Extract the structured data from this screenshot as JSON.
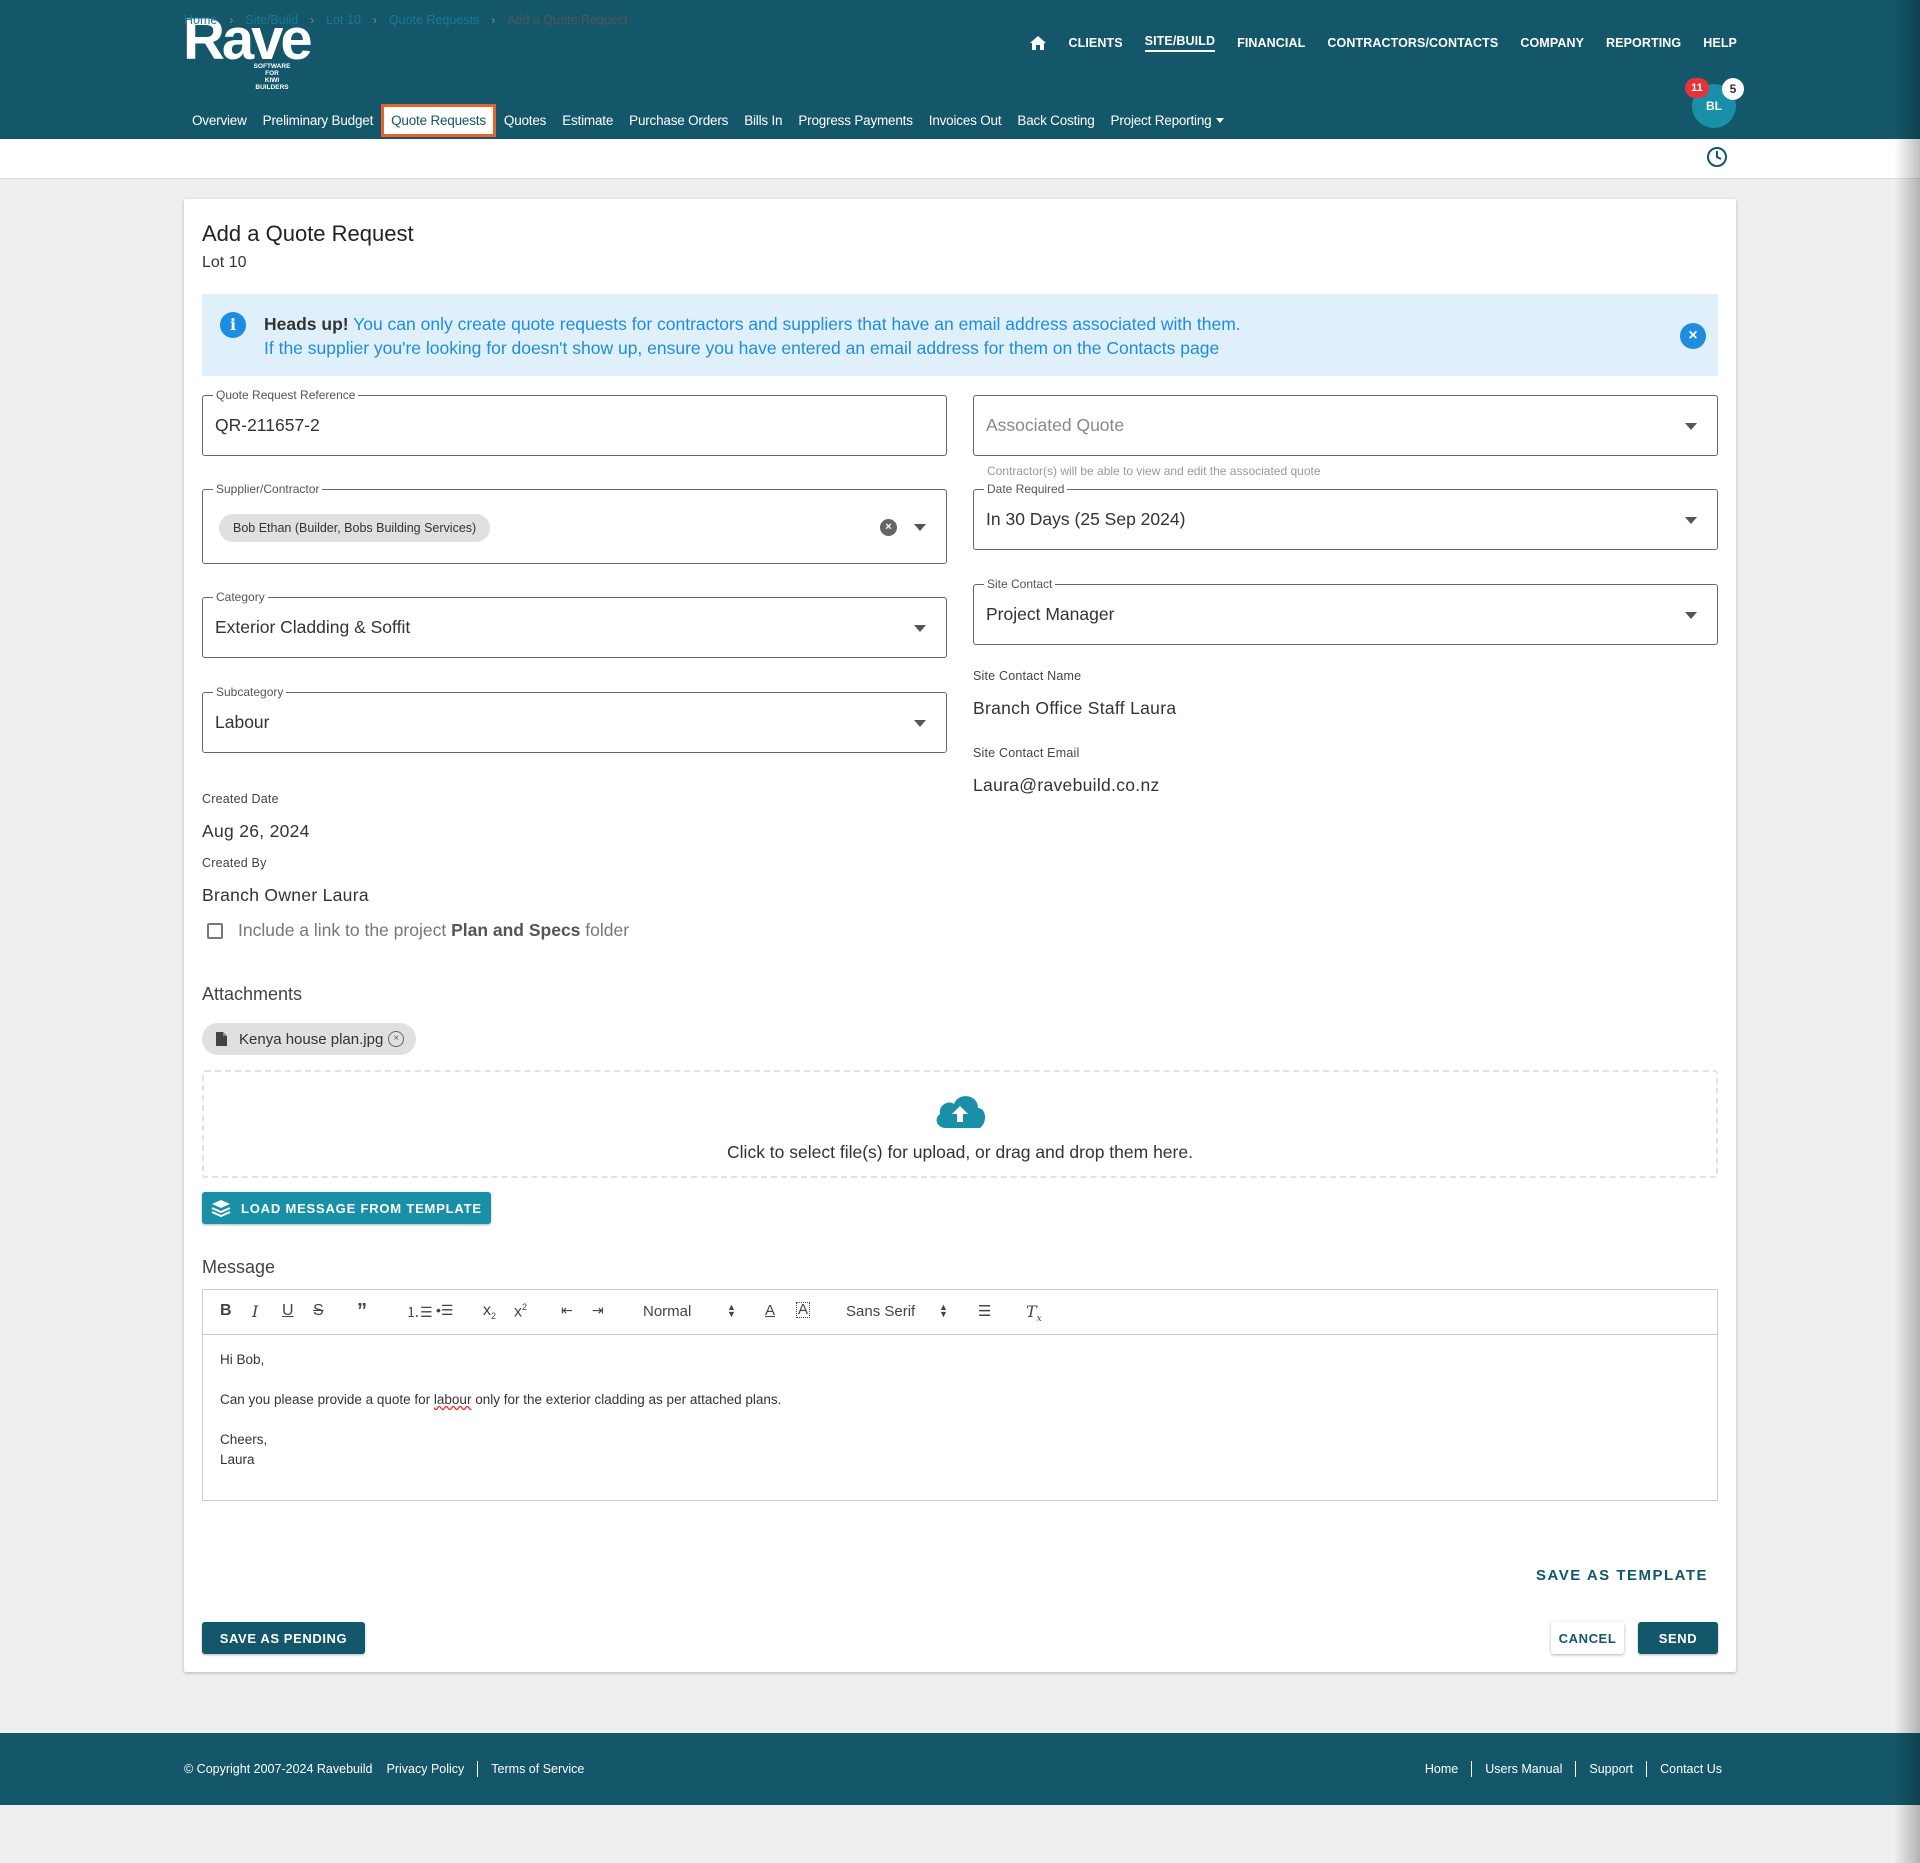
{
  "brand": {
    "name": "Rave",
    "tagline_1": "SOFTWARE FOR",
    "tagline_2": "KIWI BUILDERS"
  },
  "top_nav": [
    "CLIENTS",
    "SITE/BUILD",
    "FINANCIAL",
    "CONTRACTORS/CONTACTS",
    "COMPANY",
    "REPORTING",
    "HELP"
  ],
  "sub_nav": [
    "Overview",
    "Preliminary Budget",
    "Quote Requests",
    "Quotes",
    "Estimate",
    "Purchase Orders",
    "Bills In",
    "Progress Payments",
    "Invoices Out",
    "Back Costing",
    "Project Reporting"
  ],
  "user": {
    "initials": "BL",
    "notifications": "11",
    "messages": "5"
  },
  "breadcrumb": [
    "Home",
    "Site/Build",
    "Lot 10",
    "Quote Requests",
    "Add a Quote Request"
  ],
  "page": {
    "title": "Add a Quote Request",
    "subtitle": "Lot 10"
  },
  "alert": {
    "lead": "Heads up!",
    "line1": "You can only create quote requests for contractors and suppliers that have an email address associated with them.",
    "line2": "If the supplier you're looking for doesn't show up, ensure you have entered an email address for them on the Contacts page"
  },
  "form": {
    "reference": {
      "label": "Quote Request Reference",
      "value": "QR-211657-2"
    },
    "associated_quote": {
      "placeholder": "Associated Quote",
      "helper": "Contractor(s) will be able to view and edit the associated quote"
    },
    "supplier": {
      "label": "Supplier/Contractor",
      "chip": "Bob Ethan (Builder, Bobs Building Services)"
    },
    "date_required": {
      "label": "Date Required",
      "value": "In 30 Days (25 Sep 2024)"
    },
    "category": {
      "label": "Category",
      "value": "Exterior Cladding & Soffit"
    },
    "site_contact": {
      "label": "Site Contact",
      "value": "Project Manager"
    },
    "subcategory": {
      "label": "Subcategory",
      "value": "Labour"
    },
    "site_contact_name": {
      "label": "Site Contact Name",
      "value": "Branch Office Staff Laura"
    },
    "site_contact_email": {
      "label": "Site Contact Email",
      "value": "Laura@ravebuild.co.nz"
    },
    "created_date": {
      "label": "Created Date",
      "value": "Aug 26, 2024"
    },
    "created_by": {
      "label": "Created By",
      "value": "Branch Owner Laura"
    },
    "plan_link": {
      "pre": "Include a link to the project",
      "bold": "Plan and Specs",
      "post": "folder",
      "checked": false
    }
  },
  "attachments": {
    "label": "Attachments",
    "files": [
      "Kenya house plan.jpg"
    ],
    "dropzone_text": "Click to select file(s) for upload, or drag and drop them here."
  },
  "template_button": "LOAD MESSAGE FROM TEMPLATE",
  "message": {
    "label": "Message",
    "toolbar": {
      "size": "Normal",
      "font": "Sans Serif"
    },
    "greeting": "Hi Bob,",
    "body_pre": "Can you please provide a quote for",
    "body_word": "labour",
    "body_post": "only for the exterior cladding as per attached plans.",
    "signoff": "Cheers,",
    "signature": "Laura"
  },
  "actions": {
    "save_template": "SAVE AS TEMPLATE",
    "save_pending": "SAVE AS PENDING",
    "cancel": "CANCEL",
    "send": "SEND"
  },
  "footer": {
    "copyright": "© Copyright 2007-2024 Ravebuild",
    "left_links": [
      "Privacy Policy",
      "Terms of Service"
    ],
    "right_links": [
      "Home",
      "Users Manual",
      "Support",
      "Contact Us"
    ]
  },
  "colors": {
    "brand": "#14566a",
    "accent": "#1a8fa8",
    "highlight": "#e8632a",
    "info": "#1e8de0"
  }
}
